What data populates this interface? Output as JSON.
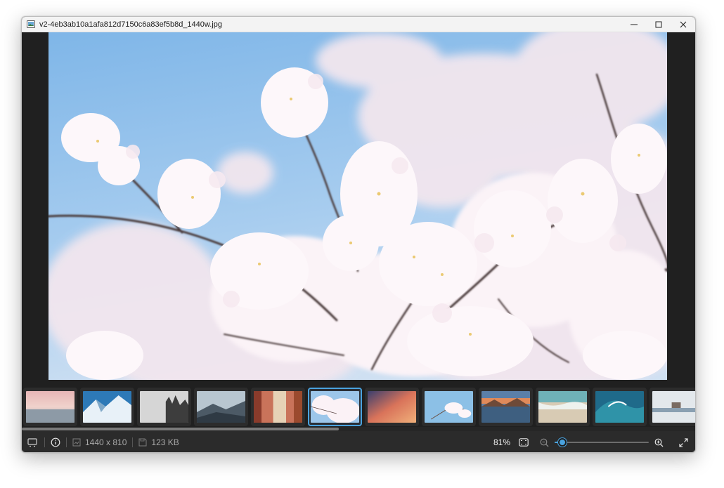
{
  "window": {
    "title": "v2-4eb3ab10a1afa812d7150c6a83ef5b8d_1440w.jpg",
    "controls": [
      "minimize-icon",
      "maximize-icon",
      "close-icon"
    ]
  },
  "viewer": {
    "photo_subject": "cherry-blossoms",
    "colors": {
      "accent": "#4aa3df",
      "background": "#202020",
      "statusbar": "#2b2b2b"
    }
  },
  "filmstrip": {
    "active_index": 5,
    "thumbnails": [
      {
        "theme": "pink-sea"
      },
      {
        "theme": "snow-mountain"
      },
      {
        "theme": "foggy-forest"
      },
      {
        "theme": "misty-hills"
      },
      {
        "theme": "autumn-forest"
      },
      {
        "theme": "cherry-blossom"
      },
      {
        "theme": "sunset-clouds"
      },
      {
        "theme": "blossom-sky"
      },
      {
        "theme": "lake-sunset"
      },
      {
        "theme": "beach"
      },
      {
        "theme": "ocean-wave"
      },
      {
        "theme": "winter-lake"
      }
    ],
    "scroll_fraction": 0.47
  },
  "statusbar": {
    "dimensions": "1440 x 810",
    "file_size": "123 KB",
    "zoom": "81%",
    "zoom_level": 0.08,
    "icons": {
      "filmstrip_toggle": "filmstrip-icon",
      "info": "info-icon",
      "dimensions": "image-size-icon",
      "size": "save-icon",
      "fit": "fit-screen-icon",
      "zoom_out": "zoom-out-icon",
      "zoom_in": "zoom-in-icon",
      "fullscreen": "fullscreen-icon"
    }
  }
}
